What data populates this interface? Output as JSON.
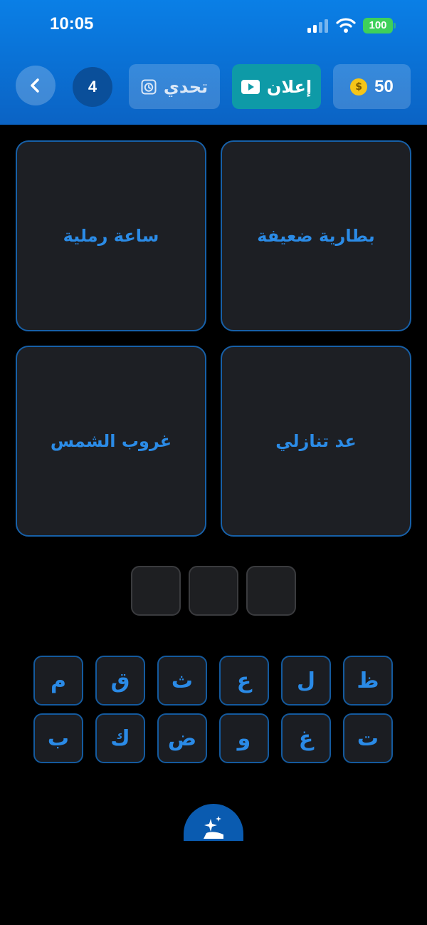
{
  "status": {
    "time": "10:05",
    "battery": "100"
  },
  "header": {
    "level": "4",
    "challenge_label": "تحدي",
    "ad_label": "إعلان",
    "coins": "50",
    "coin_symbol": "$"
  },
  "clues": [
    {
      "text": "بطارية ضعيفة"
    },
    {
      "text": "ساعة رملية"
    },
    {
      "text": "عد تنازلي"
    },
    {
      "text": "غروب الشمس"
    }
  ],
  "answer_slots": 3,
  "keyboard": {
    "row1": [
      "ظ",
      "ل",
      "ع",
      "ث",
      "ق",
      "م"
    ],
    "row2": [
      "ت",
      "غ",
      "و",
      "ض",
      "ك",
      "ب"
    ]
  },
  "colors": {
    "header_top": "#0a7fe6",
    "accent_text": "#2b8be6",
    "card_border": "#1760a8",
    "ad_button": "#0e9aa7",
    "battery": "#3ed05a",
    "coin": "#f5c518"
  },
  "icons": {
    "back": "chevron-left-icon",
    "challenge": "timer-icon",
    "ad": "play-icon",
    "coin": "coin-icon",
    "hint": "sparkles-icon"
  }
}
